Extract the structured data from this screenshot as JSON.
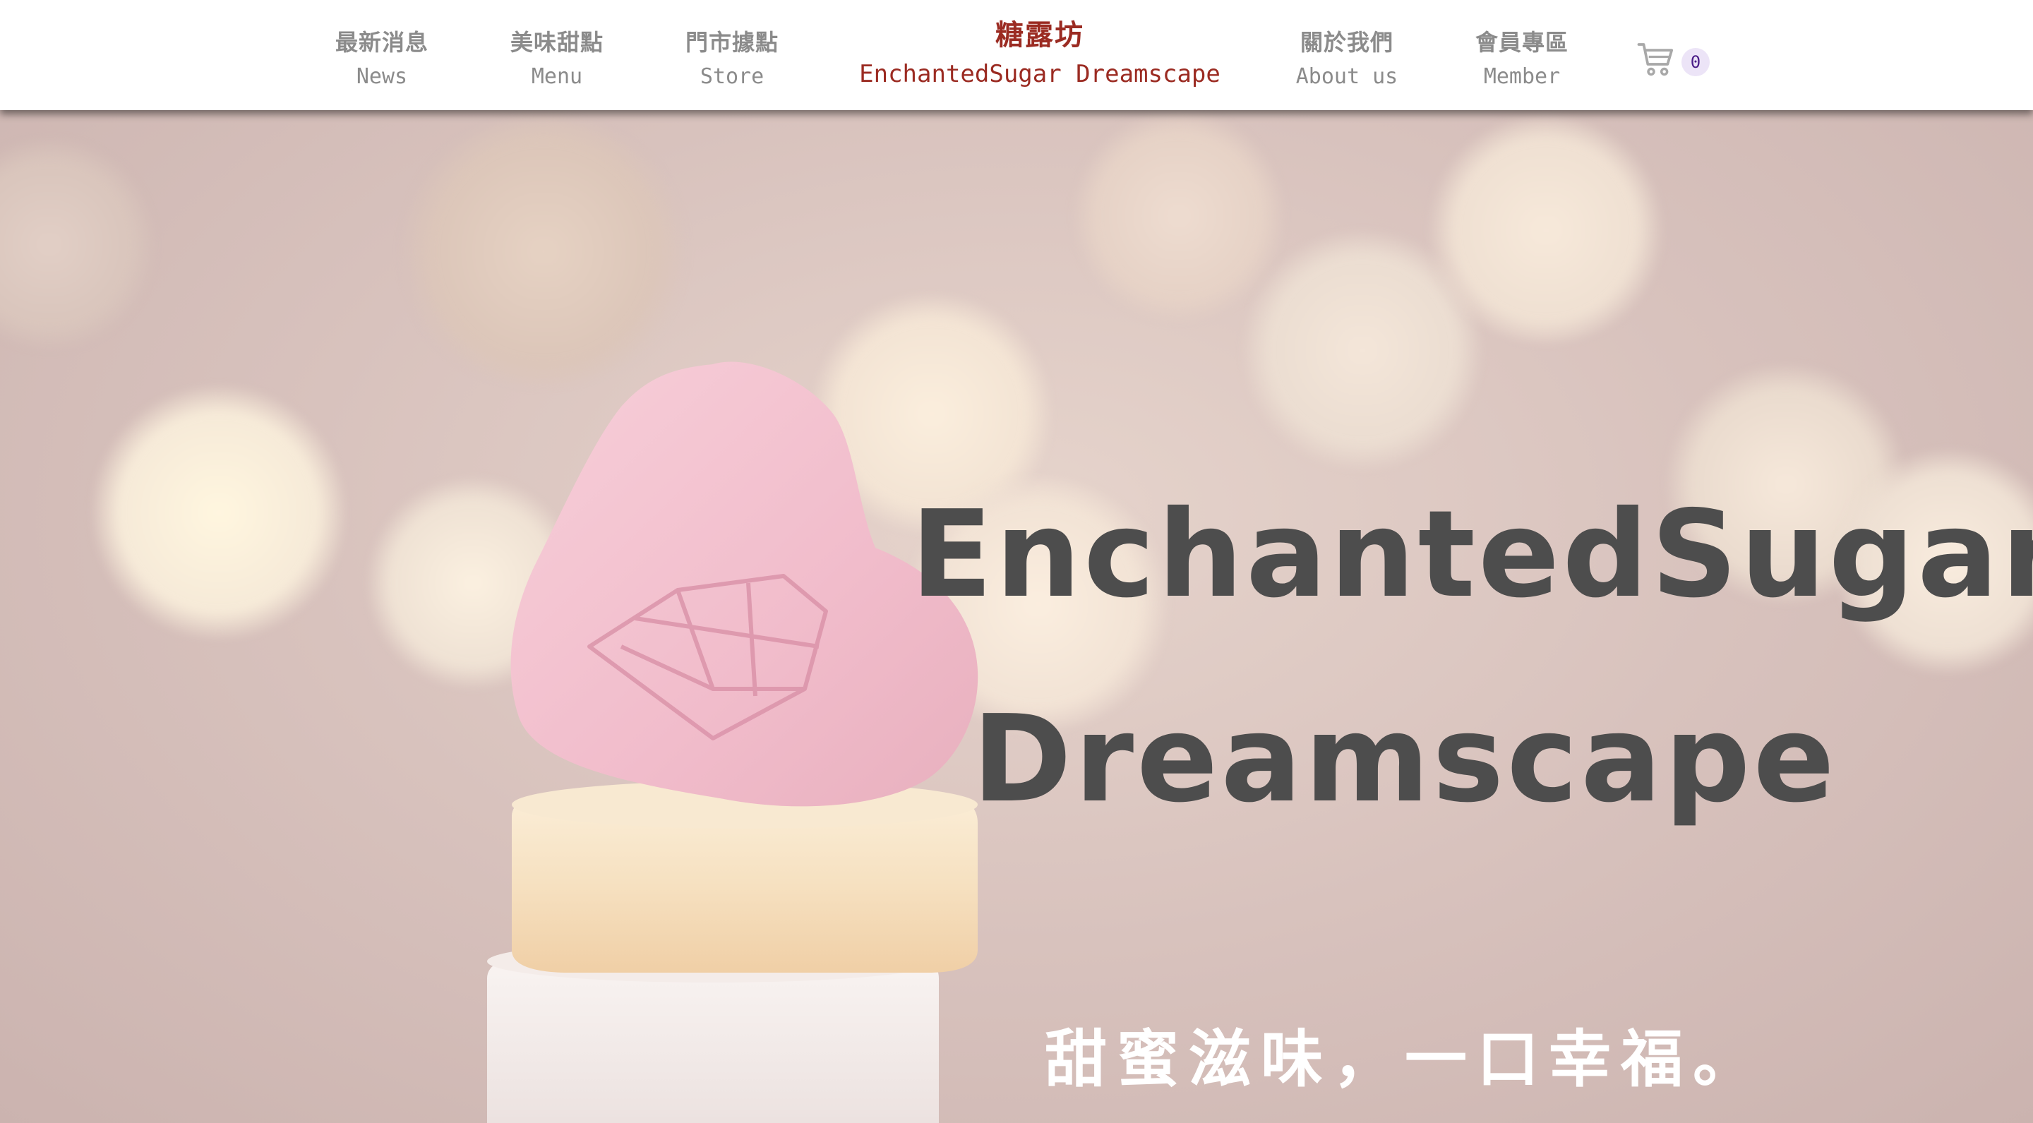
{
  "nav": {
    "news": {
      "zh": "最新消息",
      "en": "News"
    },
    "menu": {
      "zh": "美味甜點",
      "en": "Menu"
    },
    "store": {
      "zh": "門市據點",
      "en": "Store"
    },
    "about": {
      "zh": "關於我們",
      "en": "About us"
    },
    "member": {
      "zh": "會員專區",
      "en": "Member"
    }
  },
  "brand": {
    "zh": "糖露坊",
    "en": "EnchantedSugar Dreamscape"
  },
  "cart": {
    "count": "0",
    "icon": "cart-icon"
  },
  "hero": {
    "title_line1": "EnchantedSugar",
    "title_line2": "Dreamscape",
    "tagline": "甜蜜滋味，一口幸福。"
  },
  "colors": {
    "brand": "#9b2b22",
    "nav_text": "#8b8b8b",
    "hero_title": "#4d4d4d",
    "tagline": "#ffffff",
    "badge_bg": "#ece4f7",
    "badge_text": "#4a1c87"
  }
}
